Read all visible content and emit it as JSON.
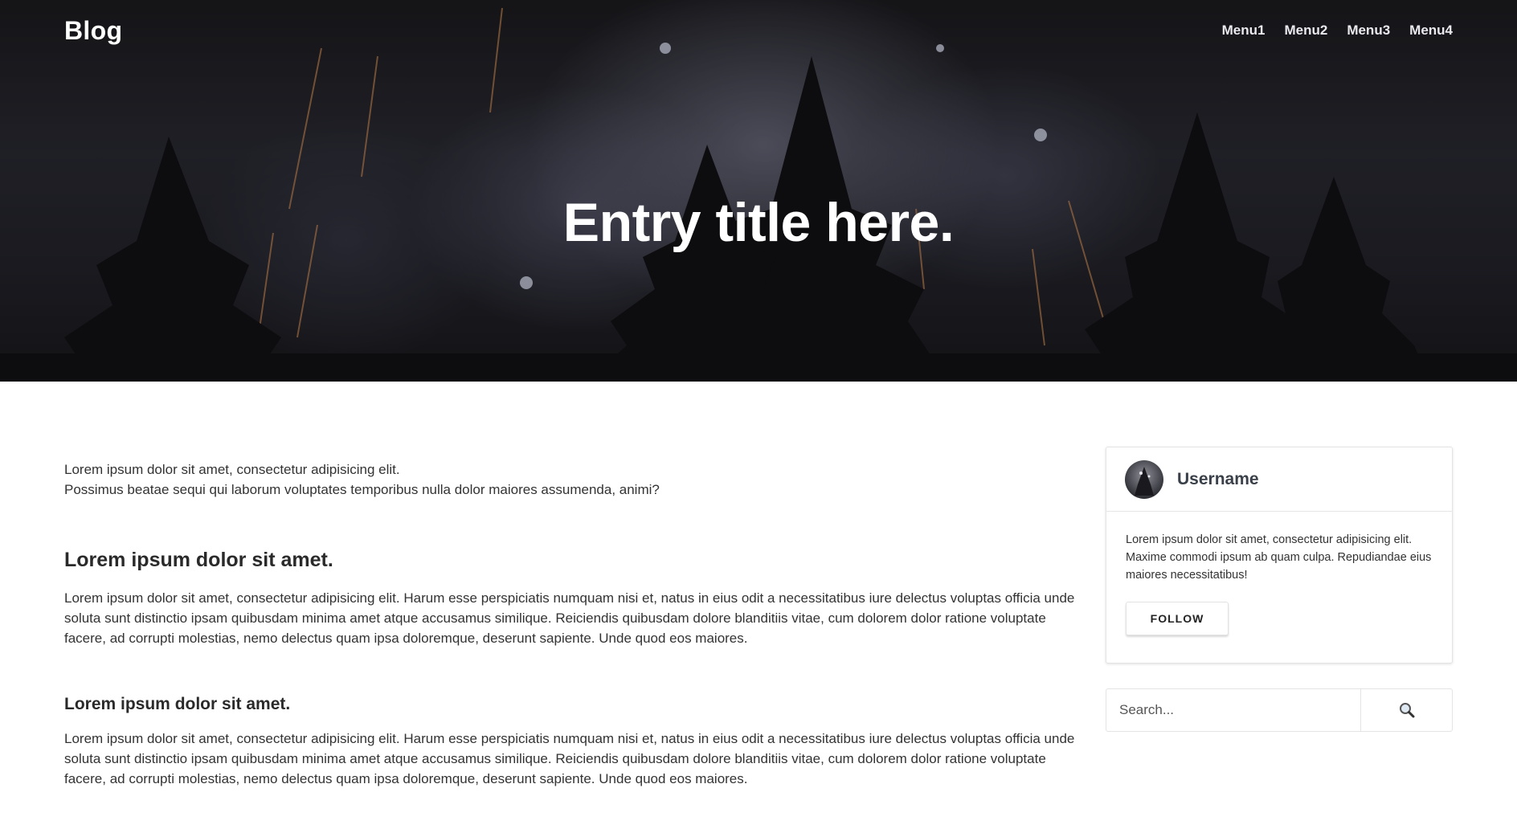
{
  "brand": "Blog",
  "nav": [
    "Menu1",
    "Menu2",
    "Menu3",
    "Menu4"
  ],
  "hero": {
    "title": "Entry title here."
  },
  "article": {
    "intro_line1": "Lorem ipsum dolor sit amet, consectetur adipisicing elit.",
    "intro_line2": "Possimus beatae sequi qui laborum voluptates temporibus nulla dolor maiores assumenda, animi?",
    "sections": [
      {
        "heading": "Lorem ipsum dolor sit amet.",
        "body": "Lorem ipsum dolor sit amet, consectetur adipisicing elit. Harum esse perspiciatis numquam nisi et, natus in eius odit a necessitatibus iure delectus voluptas officia unde soluta sunt distinctio ipsam quibusdam minima amet atque accusamus similique. Reiciendis quibusdam dolore blanditiis vitae, cum dolorem dolor ratione voluptate facere, ad corrupti molestias, nemo delectus quam ipsa doloremque, deserunt sapiente. Unde quod eos maiores."
      },
      {
        "heading": "Lorem ipsum dolor sit amet.",
        "body": "Lorem ipsum dolor sit amet, consectetur adipisicing elit. Harum esse perspiciatis numquam nisi et, natus in eius odit a necessitatibus iure delectus voluptas officia unde soluta sunt distinctio ipsam quibusdam minima amet atque accusamus similique. Reiciendis quibusdam dolore blanditiis vitae, cum dolorem dolor ratione voluptate facere, ad corrupti molestias, nemo delectus quam ipsa doloremque, deserunt sapiente. Unde quod eos maiores."
      }
    ]
  },
  "sidebar": {
    "profile": {
      "username": "Username",
      "bio": "Lorem ipsum dolor sit amet, consectetur adipisicing elit. Maxime commodi ipsum ab quam culpa. Repudiandae eius maiores necessitatibus!",
      "follow_label": "FOLLOW"
    },
    "search": {
      "placeholder": "Search...",
      "icon": "search-icon"
    }
  }
}
